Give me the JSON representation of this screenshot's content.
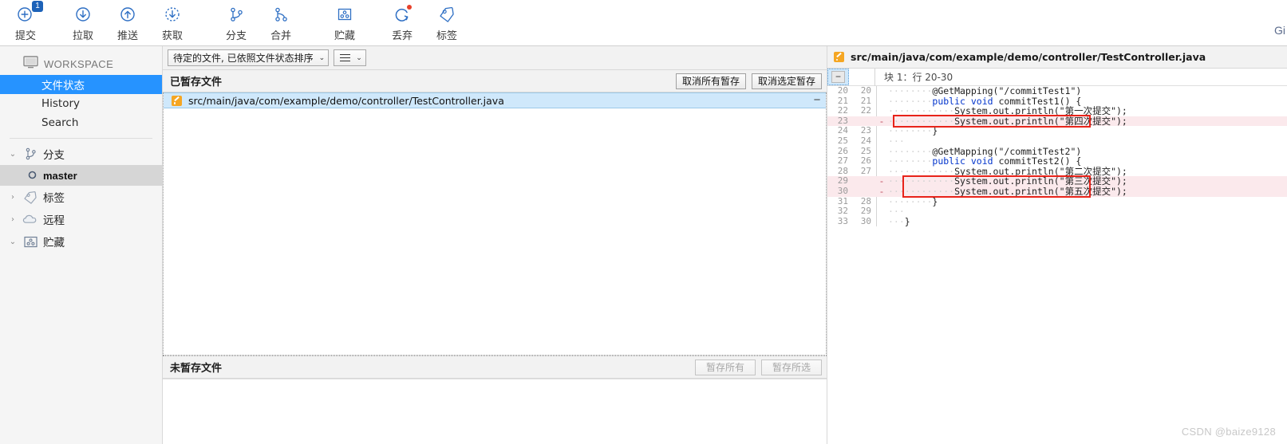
{
  "toolbar": {
    "items": [
      {
        "label": "提交",
        "icon": "commit-plus-icon",
        "badge": "1"
      },
      {
        "label": "拉取",
        "icon": "pull-down-arrow-icon"
      },
      {
        "label": "推送",
        "icon": "push-up-arrow-icon"
      },
      {
        "label": "获取",
        "icon": "fetch-dashed-arrow-icon"
      },
      {
        "label": "分支",
        "icon": "branch-icon"
      },
      {
        "label": "合并",
        "icon": "merge-icon"
      },
      {
        "label": "贮藏",
        "icon": "stash-icon"
      },
      {
        "label": "丢弃",
        "icon": "discard-refresh-icon",
        "dot": true
      },
      {
        "label": "标签",
        "icon": "tag-icon"
      }
    ],
    "corner_text": "Gi"
  },
  "sidebar": {
    "workspace_label": "WORKSPACE",
    "workspace_icon": "monitor-icon",
    "items": [
      {
        "label": "文件状态",
        "selected": true
      },
      {
        "label": "History",
        "selected": false
      },
      {
        "label": "Search",
        "selected": false
      }
    ],
    "groups": [
      {
        "label": "分支",
        "icon": "branch-icon",
        "expanded": true,
        "chevron": "⌄"
      },
      {
        "label": "标签",
        "icon": "tag-icon",
        "expanded": false,
        "chevron": "›"
      },
      {
        "label": "远程",
        "icon": "cloud-icon",
        "expanded": false,
        "chevron": "›"
      },
      {
        "label": "贮藏",
        "icon": "stash-icon",
        "expanded": true,
        "chevron": "⌄"
      }
    ],
    "branch": {
      "label": "master",
      "icon": "branch-dot-icon"
    }
  },
  "center": {
    "filter_combo": {
      "value": "待定的文件, 已依照文件状态排序",
      "caret": "⌄"
    },
    "view_combo": {
      "icon": "list-view-icon",
      "caret": "⌄"
    },
    "staged": {
      "title": "已暂存文件",
      "unstage_all_label": "取消所有暂存",
      "unstage_selected_label": "取消选定暂存",
      "files": [
        {
          "path": "src/main/java/com/example/demo/controller/TestController.java",
          "status_icon": "modified-file-icon",
          "action": "−"
        }
      ]
    },
    "unstaged": {
      "title": "未暂存文件",
      "stage_all_label": "暂存所有",
      "stage_selected_label": "暂存所选",
      "files": []
    }
  },
  "diff": {
    "file_path": "src/main/java/com/example/demo/controller/TestController.java",
    "file_icon": "modified-file-icon",
    "hunk_label": "块 1：行 20-30",
    "collapse_icon": "minus-icon",
    "lines": [
      {
        "old": "20",
        "new": "20",
        "mark": "",
        "type": "ctx",
        "text": "    @GetMapping(\"/commitTest1\")",
        "indent": 8
      },
      {
        "old": "21",
        "new": "21",
        "mark": "",
        "type": "ctx",
        "text": "    public void commitTest1() {",
        "indent": 8
      },
      {
        "old": "22",
        "new": "22",
        "mark": "",
        "type": "ctx",
        "text": "        System.out.println(\"第一次提交\");",
        "indent": 12
      },
      {
        "old": "23",
        "new": "",
        "mark": "-",
        "type": "del",
        "text": "        System.out.println(\"第四次提交\");",
        "indent": 12
      },
      {
        "old": "24",
        "new": "23",
        "mark": "",
        "type": "ctx",
        "text": "    }",
        "indent": 8
      },
      {
        "old": "25",
        "new": "24",
        "mark": "",
        "type": "ctx",
        "text": "",
        "indent": 3
      },
      {
        "old": "26",
        "new": "25",
        "mark": "",
        "type": "ctx",
        "text": "    @GetMapping(\"/commitTest2\")",
        "indent": 8
      },
      {
        "old": "27",
        "new": "26",
        "mark": "",
        "type": "ctx",
        "text": "    public void commitTest2() {",
        "indent": 8
      },
      {
        "old": "28",
        "new": "27",
        "mark": "",
        "type": "ctx",
        "text": "        System.out.println(\"第二次提交\");",
        "indent": 12
      },
      {
        "old": "29",
        "new": "",
        "mark": "-",
        "type": "del",
        "text": "        System.out.println(\"第三次提交\");",
        "indent": 12
      },
      {
        "old": "30",
        "new": "",
        "mark": "-",
        "type": "del",
        "text": "        System.out.println(\"第五次提交\");",
        "indent": 12
      },
      {
        "old": "31",
        "new": "28",
        "mark": "",
        "type": "ctx",
        "text": "    }",
        "indent": 8
      },
      {
        "old": "32",
        "new": "29",
        "mark": "",
        "type": "ctx",
        "text": "",
        "indent": 3
      },
      {
        "old": "33",
        "new": "30",
        "mark": "",
        "type": "ctx",
        "text": "}",
        "indent": 3
      }
    ]
  },
  "watermark": "CSDN @baize9128",
  "colors": {
    "accent": "#2693ff",
    "badge": "#1d62b8",
    "delete_bg": "#fbe9ec",
    "highlight_border": "#e8231a",
    "modified_icon": "#f5a623"
  }
}
